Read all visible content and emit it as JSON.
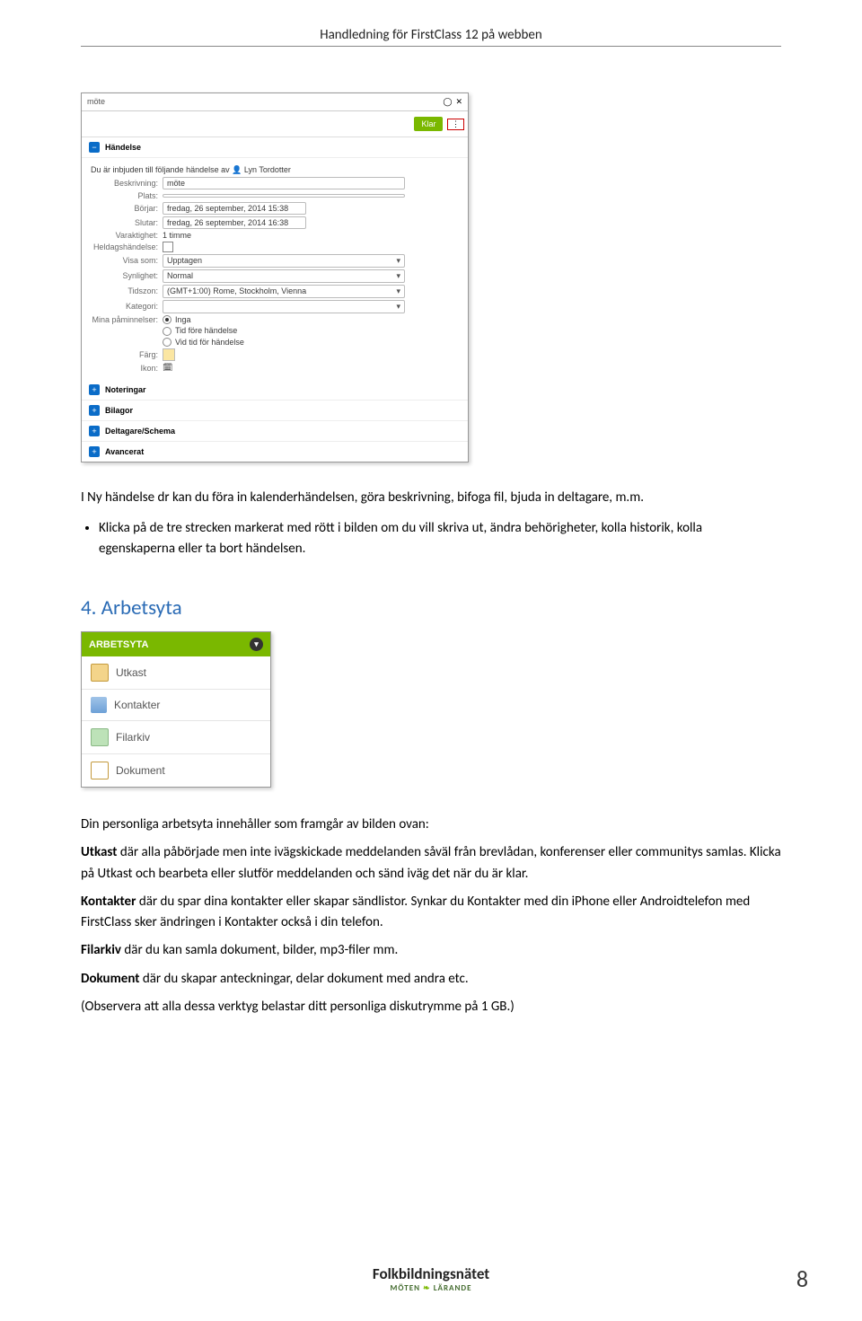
{
  "header": "Handledning för FirstClass 12 på webben",
  "shot1": {
    "title": "möte",
    "klar": "Klar",
    "dots": "⋮",
    "panel_handelse": "Händelse",
    "invite_text": "Du är inbjuden till följande händelse av",
    "invite_name": "Lyn Tordotter",
    "fields": {
      "beskrivning_lbl": "Beskrivning:",
      "beskrivning_val": "möte",
      "plats_lbl": "Plats:",
      "plats_val": "",
      "borjar_lbl": "Börjar:",
      "borjar_val": "fredag, 26 september, 2014 15:38",
      "slutar_lbl": "Slutar:",
      "slutar_val": "fredag, 26 september, 2014 16:38",
      "varaktighet_lbl": "Varaktighet:",
      "varaktighet_val": "1 timme",
      "heldag_lbl": "Heldagshändelse:",
      "visa_lbl": "Visa som:",
      "visa_val": "Upptagen",
      "synlighet_lbl": "Synlighet:",
      "synlighet_val": "Normal",
      "tidszon_lbl": "Tidszon:",
      "tidszon_val": "(GMT+1:00) Rome, Stockholm, Vienna",
      "kategori_lbl": "Kategori:",
      "kategori_val": "",
      "paminnelser_lbl": "Mina påminnelser:",
      "r1": "Inga",
      "r2": "Tid före händelse",
      "r3": "Vid tid för händelse",
      "farg_lbl": "Färg:",
      "ikon_lbl": "Ikon:"
    },
    "panel_noteringar": "Noteringar",
    "panel_bilagor": "Bilagor",
    "panel_deltagare": "Deltagare/Schema",
    "panel_avancerat": "Avancerat"
  },
  "para1": "I Ny händelse dr kan du föra in kalenderhändelsen, göra beskrivning, bifoga fil, bjuda in deltagare, m.m.",
  "bullet1": "Klicka på de tre strecken markerat med rött i bilden om du vill skriva ut, ändra behörigheter, kolla historik, kolla egenskaperna eller ta bort händelsen.",
  "section_heading": "4. Arbetsyta",
  "shot2": {
    "header": "ARBETSYTA",
    "items": {
      "utkast": "Utkast",
      "kontakter": "Kontakter",
      "filarkiv": "Filarkiv",
      "dokument": "Dokument"
    }
  },
  "para2_a": "Din personliga arbetsyta innehåller som framgår av bilden ovan:",
  "para2_b1": "Utkast",
  "para2_b2": " där alla påbörjade men inte ivägskickade meddelanden såväl från brevlådan, konferenser eller communitys samlas. Klicka på Utkast och bearbeta eller slutför meddelanden och sänd iväg det när du är klar.",
  "para2_c1": "Kontakter",
  "para2_c2": " där du spar dina kontakter eller skapar sändlistor. Synkar du Kontakter med din iPhone eller Androidtelefon med FirstClass sker ändringen i Kontakter också i din telefon.",
  "para2_d1": "Filarkiv",
  "para2_d2": " där du kan samla dokument, bilder, mp3-filer mm.",
  "para2_e1": "Dokument",
  "para2_e2": " där du skapar anteckningar, delar dokument med andra etc.",
  "para2_f": "(Observera att alla dessa verktyg belastar ditt personliga diskutrymme på 1 GB.)",
  "footer_brand": "Folkbildningsnätet",
  "footer_tag1": "MÖTEN",
  "footer_tag2": "LÄRANDE",
  "page_number": "8"
}
